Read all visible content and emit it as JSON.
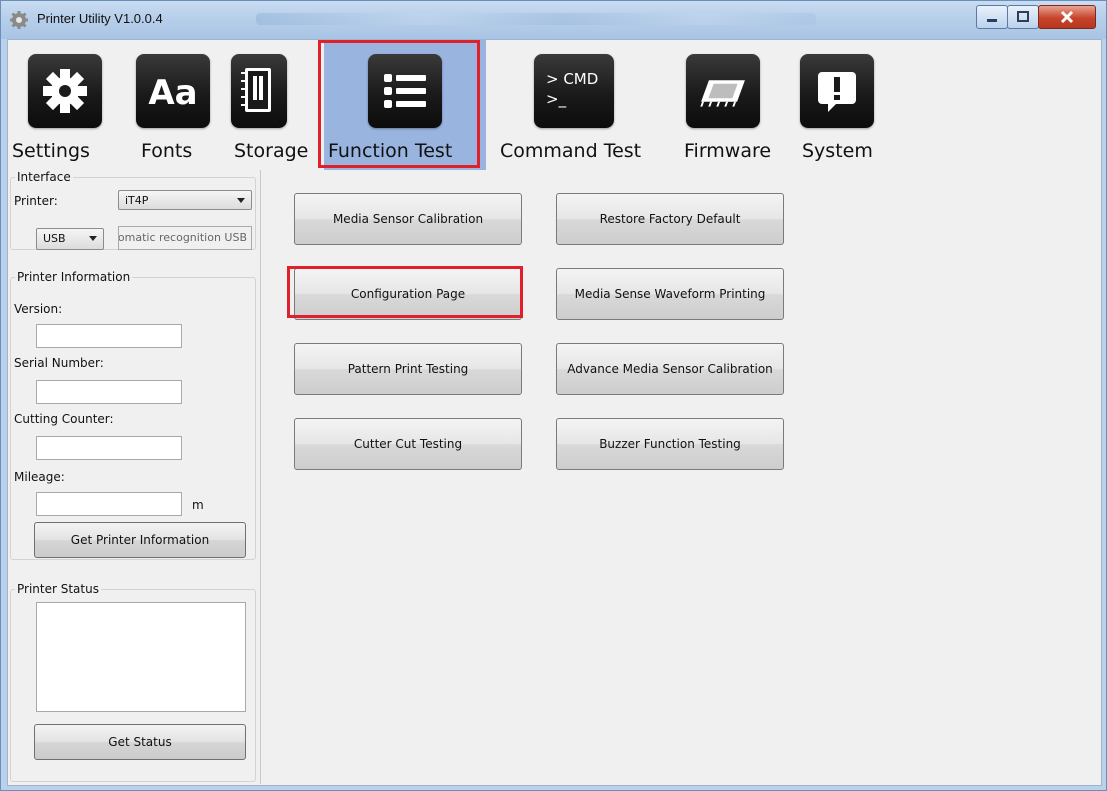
{
  "window": {
    "title": "Printer Utility  V1.0.0.4"
  },
  "toolbar": {
    "items": [
      {
        "label": "Settings",
        "icon": "gear-icon"
      },
      {
        "label": "Fonts",
        "icon": "aa-font-icon"
      },
      {
        "label": "Storage",
        "icon": "notebook-icon"
      },
      {
        "label": "Function Test",
        "icon": "list-icon",
        "selected": true
      },
      {
        "label": "Command Test",
        "icon": "cmd-icon",
        "icon_text": "> CMD\n>_"
      },
      {
        "label": "Firmware",
        "icon": "chip-icon"
      },
      {
        "label": "System",
        "icon": "exclamation-icon"
      }
    ]
  },
  "interface": {
    "legend": "Interface",
    "printer_label": "Printer:",
    "printer_value": "iT4P",
    "port_value": "USB",
    "port_hint": "Automatic recognition USB"
  },
  "printer_info": {
    "legend": "Printer Information",
    "version_label": "Version:",
    "version_value": "",
    "serial_label": "Serial Number:",
    "serial_value": "",
    "cutting_label": "Cutting Counter:",
    "cutting_value": "",
    "mileage_label": "Mileage:",
    "mileage_value": "",
    "mileage_unit": "m",
    "get_info_button": "Get Printer Information"
  },
  "printer_status": {
    "legend": "Printer Status",
    "status_text": "",
    "get_status_button": "Get Status"
  },
  "function_test": {
    "buttons": [
      "Media Sensor Calibration",
      "Restore Factory Default",
      "Configuration Page",
      "Media Sense Waveform Printing",
      "Pattern Print Testing",
      "Advance Media Sensor Calibration",
      "Cutter Cut Testing",
      "Buzzer Function Testing"
    ]
  },
  "colors": {
    "highlight_red": "#e0202b",
    "selected_tab_blue": "#9ab4e0"
  }
}
